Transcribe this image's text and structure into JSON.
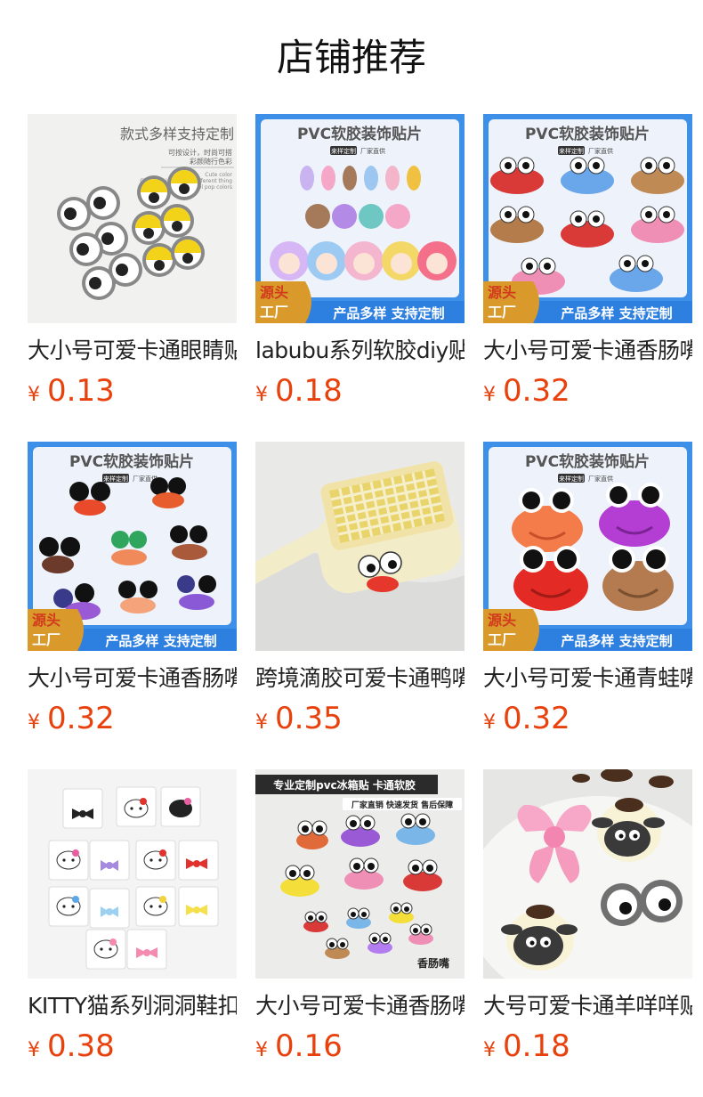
{
  "page": {
    "title": "店铺推荐"
  },
  "products": [
    {
      "name": "大小号可爱卡通眼睛贴",
      "currency": "¥",
      "price": "0.13",
      "image": {
        "heading": "款式多样支持定制",
        "subtext": [
          "可按设计，时尚可搭",
          "彩颜随行色彩"
        ],
        "caption": [
          "Cute color",
          "Colorful pieces with different thing",
          "Cool pop colors"
        ]
      }
    },
    {
      "name": "labubu系列软胶diy贴",
      "currency": "¥",
      "price": "0.18",
      "image": {
        "heading": "PVC软胶装饰贴片",
        "tags": [
          "来样定制",
          "厂家直供"
        ],
        "badge": [
          "源头",
          "工厂"
        ],
        "banner": "产品多样 支持定制"
      }
    },
    {
      "name": "大小号可爱卡通香肠嘴贴",
      "currency": "¥",
      "price": "0.32",
      "image": {
        "heading": "PVC软胶装饰贴片",
        "tags": [
          "来样定制",
          "厂家直供"
        ],
        "badge": [
          "源头",
          "工厂"
        ],
        "banner": "产品多样 支持定制"
      }
    },
    {
      "name": "大小号可爱卡通香肠嘴贴",
      "currency": "¥",
      "price": "0.32",
      "image": {
        "heading": "PVC软胶装饰贴片",
        "tags": [
          "来样定制",
          "厂家直供"
        ],
        "badge": [
          "源头",
          "工厂"
        ],
        "banner": "产品多样 支持定制"
      }
    },
    {
      "name": "跨境滴胶可爱卡通鸭嘴贴",
      "currency": "¥",
      "price": "0.35",
      "image": {}
    },
    {
      "name": "大小号可爱卡通青蛙嘴贴",
      "currency": "¥",
      "price": "0.32",
      "image": {
        "heading": "PVC软胶装饰贴片",
        "tags": [
          "来样定制",
          "厂家直供"
        ],
        "badge": [
          "源头",
          "工厂"
        ],
        "banner": "产品多样 支持定制"
      }
    },
    {
      "name": "KITTY猫系列洞洞鞋扣",
      "currency": "¥",
      "price": "0.38",
      "image": {}
    },
    {
      "name": "大小号可爱卡通香肠嘴贴",
      "currency": "¥",
      "price": "0.16",
      "image": {
        "heading": "专业定制pvc冰箱贴 卡通软胶",
        "tags": [
          "厂家直销 快速发货 售后保障"
        ],
        "label": "香肠嘴"
      }
    },
    {
      "name": "大号可爱卡通羊咩咩贴",
      "currency": "¥",
      "price": "0.18",
      "image": {}
    }
  ],
  "colors": {
    "price": "#e8410c",
    "title": "#111111",
    "name": "#222222",
    "banner_blue": "#2d7fe0",
    "badge_red": "#d23a1c"
  }
}
